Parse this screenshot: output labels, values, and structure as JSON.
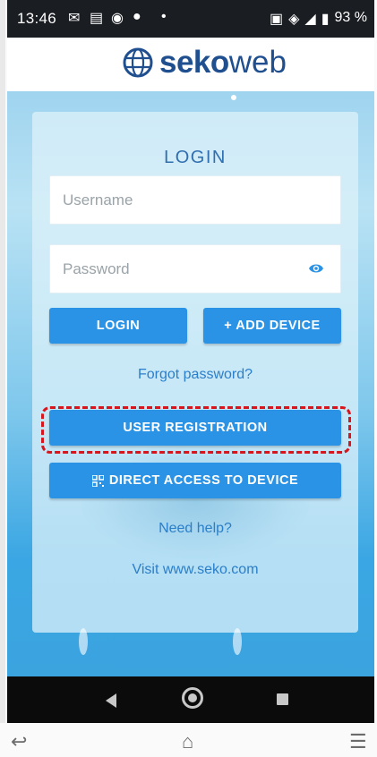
{
  "status_bar": {
    "time": "13:46",
    "left_icons": [
      "mail-icon",
      "chat-icon",
      "sync-icon",
      "app-icon"
    ],
    "dot": "•",
    "battery": "93 %"
  },
  "header": {
    "brand_bold": "seko",
    "brand_light": "web"
  },
  "login": {
    "title": "LOGIN",
    "username_placeholder": "Username",
    "password_placeholder": "Password",
    "login_button": "LOGIN",
    "add_device_button": "+ ADD DEVICE",
    "forgot_password": "Forgot password?",
    "user_registration_button": "USER REGISTRATION",
    "direct_access_button": "DIRECT ACCESS TO DEVICE",
    "need_help": "Need help?",
    "visit": "Visit www.seko.com"
  },
  "colors": {
    "accent": "#2b93e6",
    "brand": "#1f4f8f",
    "highlight": "#d6151c"
  },
  "android_nav": [
    "back-icon",
    "home-icon",
    "recent-apps-icon"
  ],
  "browser_bar": [
    "undo-icon",
    "home-icon",
    "menu-icon"
  ]
}
